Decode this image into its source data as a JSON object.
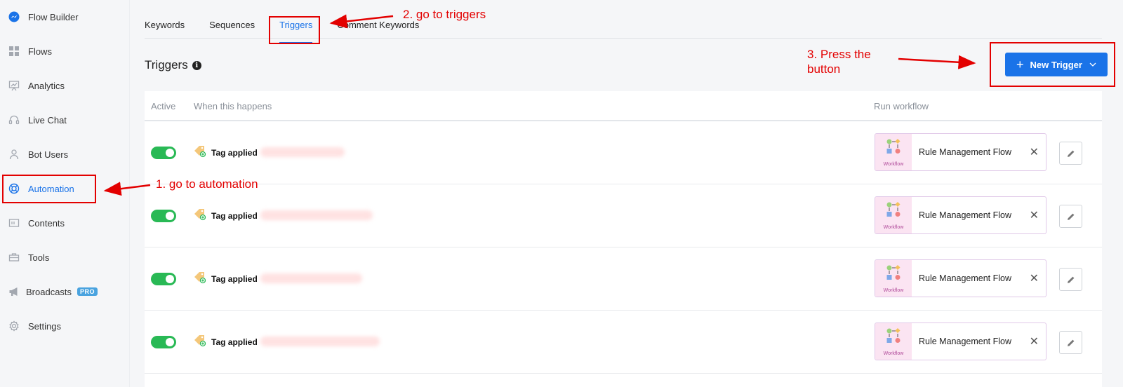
{
  "sidebar": {
    "items": [
      {
        "label": "Flow Builder",
        "icon": "messenger-icon"
      },
      {
        "label": "Flows",
        "icon": "grid-icon"
      },
      {
        "label": "Analytics",
        "icon": "chart-board-icon"
      },
      {
        "label": "Live Chat",
        "icon": "headset-icon"
      },
      {
        "label": "Bot Users",
        "icon": "user-icon"
      },
      {
        "label": "Automation",
        "icon": "lifebuoy-icon",
        "active": true
      },
      {
        "label": "Contents",
        "icon": "contents-icon"
      },
      {
        "label": "Tools",
        "icon": "toolbox-icon"
      },
      {
        "label": "Broadcasts",
        "icon": "megaphone-icon",
        "badge": "PRO"
      },
      {
        "label": "Settings",
        "icon": "gear-icon"
      }
    ]
  },
  "tabs": [
    {
      "label": "Keywords"
    },
    {
      "label": "Sequences"
    },
    {
      "label": "Triggers",
      "active": true
    },
    {
      "label": "Comment Keywords"
    }
  ],
  "page": {
    "title": "Triggers",
    "new_trigger_label": "New Trigger"
  },
  "table": {
    "headers": {
      "active": "Active",
      "when": "When this happens",
      "run": "Run workflow"
    },
    "rows": [
      {
        "active": true,
        "event": "Tag applied",
        "workflow": "Rule Management Flow",
        "thumb_label": "Workflow"
      },
      {
        "active": true,
        "event": "Tag applied",
        "workflow": "Rule Management Flow",
        "thumb_label": "Workflow"
      },
      {
        "active": true,
        "event": "Tag applied",
        "workflow": "Rule Management Flow",
        "thumb_label": "Workflow"
      },
      {
        "active": true,
        "event": "Tag applied",
        "workflow": "Rule Management Flow",
        "thumb_label": "Workflow"
      }
    ]
  },
  "annotations": {
    "step1": "1. go to automation",
    "step2": "2. go to triggers",
    "step3_line1": "3. Press the",
    "step3_line2": "button"
  },
  "colors": {
    "accent": "#1a73e8",
    "toggle_on": "#29b955",
    "annotation": "#e30000"
  }
}
